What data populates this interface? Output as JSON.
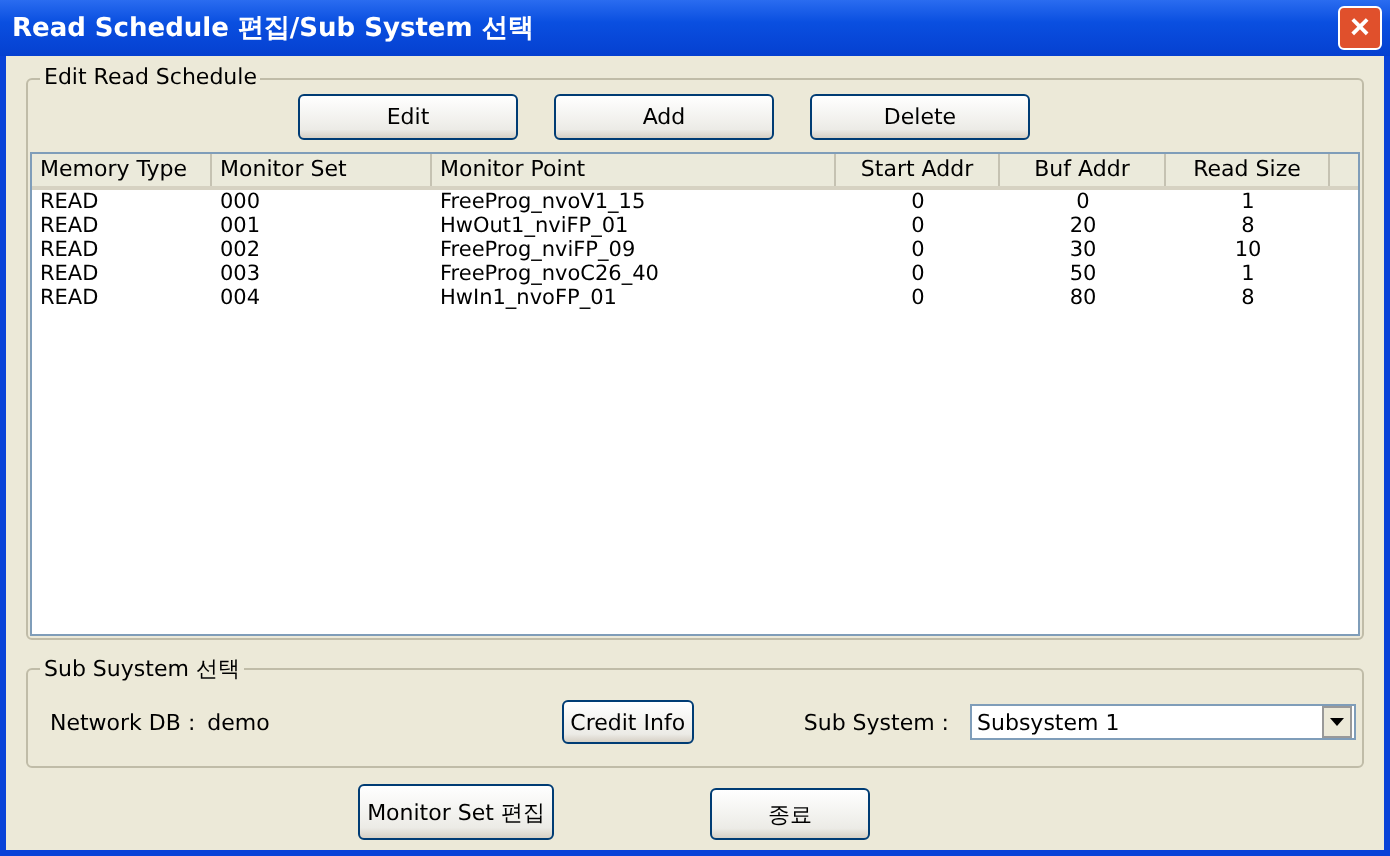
{
  "window": {
    "title": "Read Schedule 편집/Sub System 선택",
    "close": "×"
  },
  "schedule": {
    "title": "Edit Read Schedule",
    "buttons": [
      "Edit",
      "Add",
      "Delete"
    ],
    "columns": [
      "Memory Type",
      "Monitor Set",
      "Monitor Point",
      "Start Addr",
      "Buf Addr",
      "Read Size"
    ],
    "rows": [
      [
        "READ",
        "000",
        "FreeProg_nvoV1_15",
        "0",
        "0",
        "1"
      ],
      [
        "READ",
        "001",
        "HwOut1_nviFP_01",
        "0",
        "20",
        "8"
      ],
      [
        "READ",
        "002",
        "FreeProg_nviFP_09",
        "0",
        "30",
        "10"
      ],
      [
        "READ",
        "003",
        "FreeProg_nvoC26_40",
        "0",
        "50",
        "1"
      ],
      [
        "READ",
        "004",
        "HwIn1_nvoFP_01",
        "0",
        "80",
        "8"
      ]
    ]
  },
  "subsystem": {
    "title": "Sub Suystem 선택",
    "network_label": "Network DB :",
    "network_value": "demo",
    "credit_button": "Credit Info",
    "subsystem_label": "Sub System :",
    "subsystem_value": "Subsystem 1"
  },
  "buttons": [
    "Monitor Set 편집",
    "종료"
  ]
}
